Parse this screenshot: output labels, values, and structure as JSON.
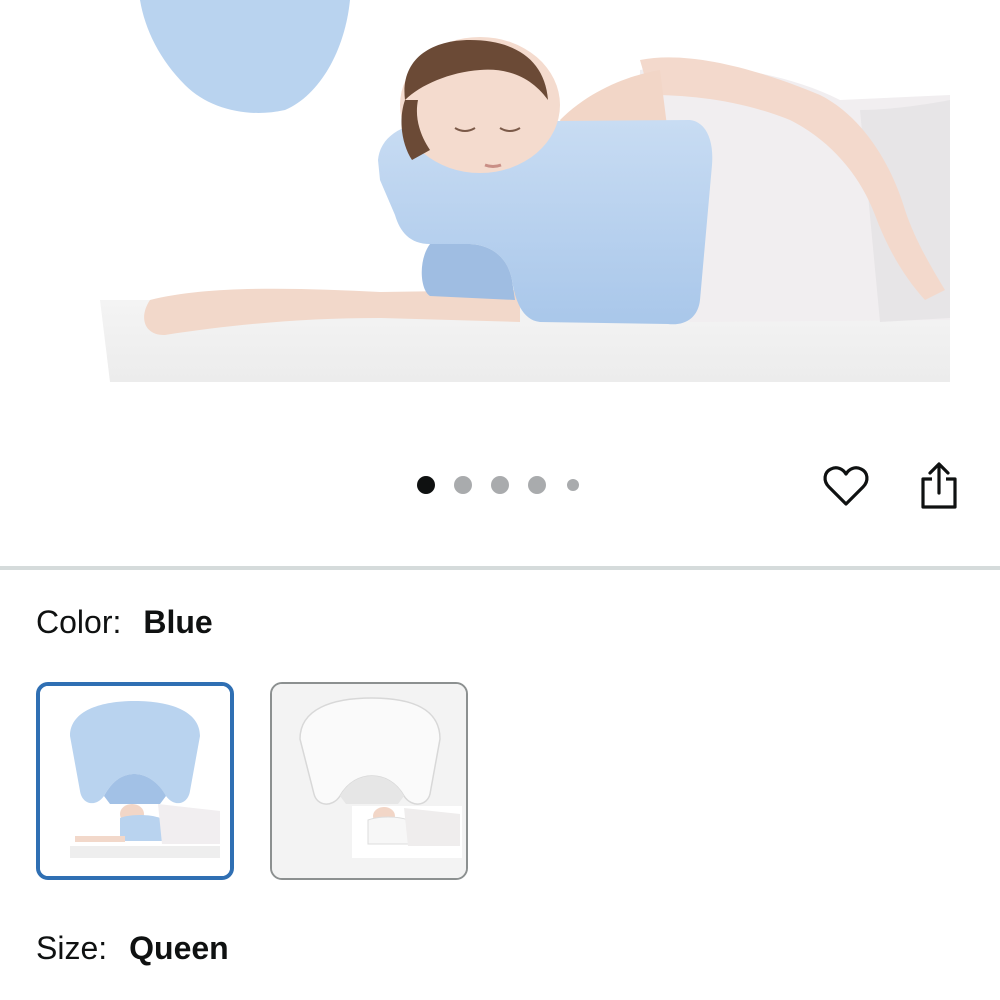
{
  "product_gallery": {
    "image_count": 5,
    "active_index": 1
  },
  "actions": {
    "wishlist_icon": "heart-icon",
    "share_icon": "share-icon"
  },
  "variations": {
    "color": {
      "label": "Color:",
      "selected_value": "Blue",
      "options": [
        "Blue",
        "White"
      ]
    },
    "size": {
      "label": "Size:",
      "selected_value": "Queen"
    }
  },
  "colors": {
    "pillow_blue": "#b9d3ef",
    "selected_border": "#2f6fb3",
    "active_dot": "#0f1111",
    "inactive_dot": "#a9abad"
  }
}
